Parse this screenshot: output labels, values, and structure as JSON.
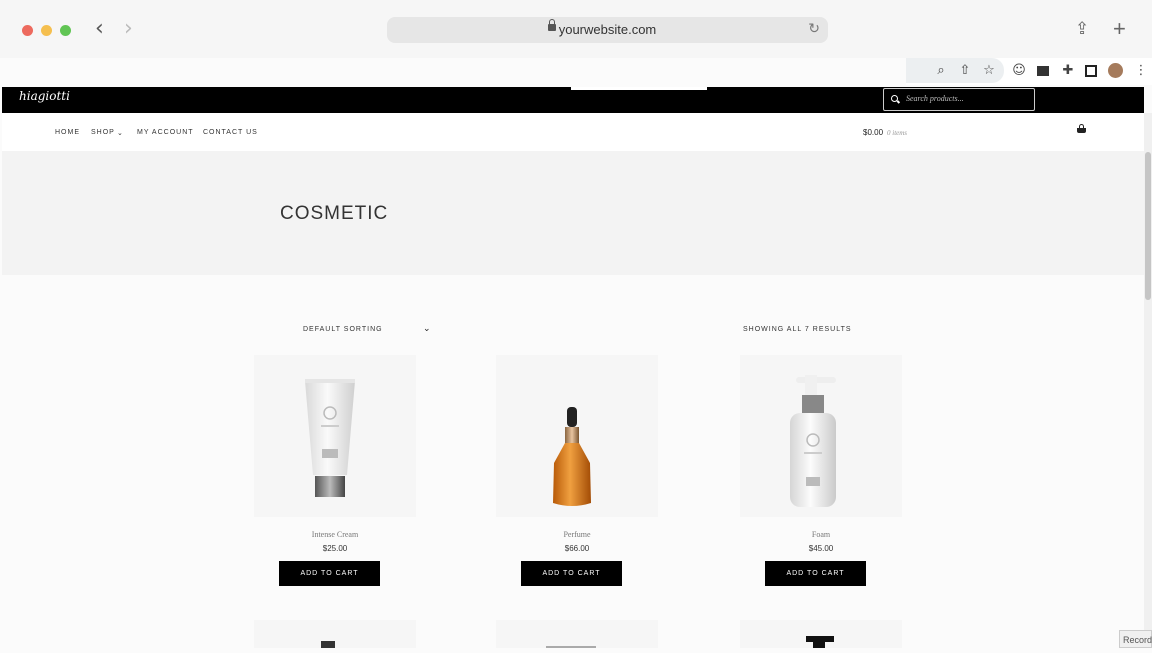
{
  "browser": {
    "url": "yourwebsite.com"
  },
  "site": {
    "logo_text": "hiagiotti",
    "search_placeholder": "Search products...",
    "nav": [
      "HOME",
      "SHOP",
      "MY ACCOUNT",
      "CONTACT US"
    ],
    "cart_total": "$0.00",
    "cart_items": "0 items"
  },
  "page": {
    "title": "COSMETIC",
    "sorting_label": "DEFAULT SORTING",
    "results_label": "SHOWING ALL 7 RESULTS"
  },
  "products": [
    {
      "name": "Intense Cream",
      "price": "$25.00",
      "button": "ADD TO CART"
    },
    {
      "name": "Perfume",
      "price": "$66.00",
      "button": "ADD TO CART"
    },
    {
      "name": "Foam",
      "price": "$45.00",
      "button": "ADD TO CART"
    }
  ],
  "record_badge": "Record",
  "colors": {
    "topbar": "#000000",
    "button": "#000000",
    "hero_bg": "#f3f3f3"
  }
}
